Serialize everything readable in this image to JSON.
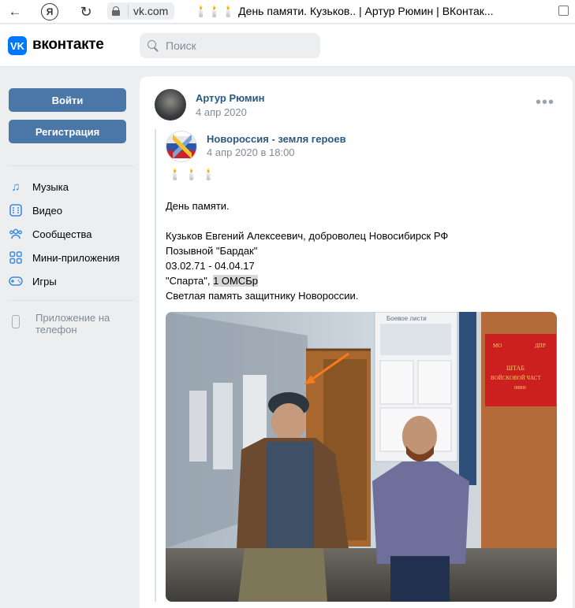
{
  "browser": {
    "url": "vk.com",
    "title": "🕯️🕯️🕯️ День памяти. Кузьков.. | Артур Рюмин | ВКонтак..."
  },
  "header": {
    "brand": "вконтакте",
    "search_placeholder": "Поиск"
  },
  "sidebar": {
    "login_label": "Войти",
    "register_label": "Регистрация",
    "items": [
      {
        "label": "Музыка",
        "icon": "music-icon"
      },
      {
        "label": "Видео",
        "icon": "video-icon"
      },
      {
        "label": "Сообщества",
        "icon": "groups-icon"
      },
      {
        "label": "Мини-приложения",
        "icon": "apps-icon"
      },
      {
        "label": "Игры",
        "icon": "games-icon"
      }
    ],
    "phone_app_label": "Приложение на телефон"
  },
  "post": {
    "author": "Артур Рюмин",
    "date": "4 апр 2020",
    "repost": {
      "group": "Новороссия - земля героев",
      "date": "4 апр 2020 в 18:00",
      "emoji": "🕯️🕯️🕯️",
      "lines": [
        "День памяти.",
        "",
        "Кузьков Евгений Алексеевич, доброволец Новосибирск РФ",
        "Позывной \"Бардак\"",
        "03.02.71 - 04.04.17"
      ],
      "line_sparta_pre": "\"Спарта\", ",
      "line_sparta_hl": "1 ОМСБр",
      "line_last": "Светлая память защитнику Новороссии."
    },
    "photo": {
      "sign_top_left": "МО",
      "sign_top_right": "ДПР",
      "sign_line1": "ШТАБ",
      "sign_line2": "ВОЙСКОВОЙ ЧАСТ",
      "sign_line3": "08806",
      "board_text": "Боевое листи"
    }
  }
}
